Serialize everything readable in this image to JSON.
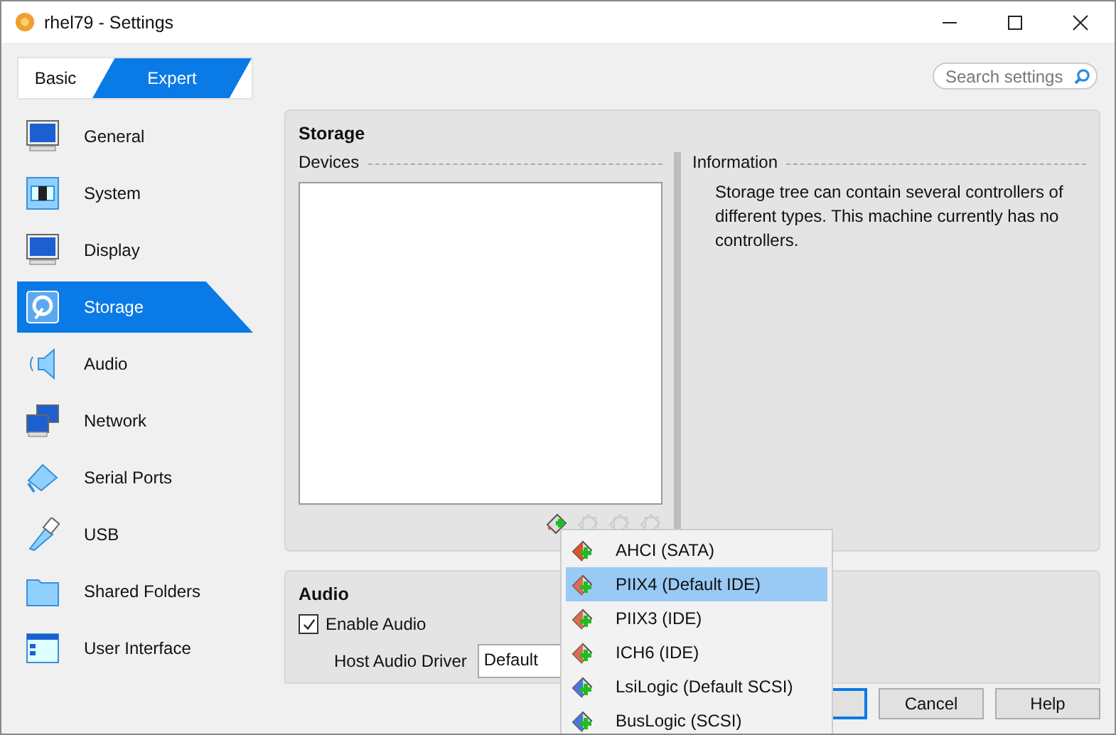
{
  "window": {
    "title": "rhel79 - Settings"
  },
  "mode_tabs": [
    {
      "label": "Basic",
      "selected": false
    },
    {
      "label": "Expert",
      "selected": true
    }
  ],
  "search": {
    "placeholder": "Search settings"
  },
  "sidebar": {
    "items": [
      {
        "label": "General",
        "selected": false
      },
      {
        "label": "System",
        "selected": false
      },
      {
        "label": "Display",
        "selected": false
      },
      {
        "label": "Storage",
        "selected": true
      },
      {
        "label": "Audio",
        "selected": false
      },
      {
        "label": "Network",
        "selected": false
      },
      {
        "label": "Serial Ports",
        "selected": false
      },
      {
        "label": "USB",
        "selected": false
      },
      {
        "label": "Shared Folders",
        "selected": false
      },
      {
        "label": "User Interface",
        "selected": false
      }
    ]
  },
  "storage": {
    "title": "Storage",
    "devices_label": "Devices",
    "information_label": "Information",
    "information_text": "Storage tree can contain several controllers of different types. This machine currently has no controllers.",
    "toolbar": [
      {
        "disabled": false
      },
      {
        "disabled": true
      },
      {
        "disabled": true
      },
      {
        "disabled": true
      }
    ]
  },
  "controller_menu": {
    "items": [
      {
        "label": "AHCI (SATA)",
        "color": "#e0502a",
        "selected": false
      },
      {
        "label": "PIIX4 (Default IDE)",
        "color": "#e06a50",
        "selected": true
      },
      {
        "label": "PIIX3 (IDE)",
        "color": "#e06a50",
        "selected": false
      },
      {
        "label": "ICH6 (IDE)",
        "color": "#e06a50",
        "selected": false
      },
      {
        "label": "LsiLogic (Default SCSI)",
        "color": "#4a78d8",
        "selected": false
      },
      {
        "label": "BusLogic (SCSI)",
        "color": "#4a78d8",
        "selected": false
      }
    ]
  },
  "audio": {
    "title": "Audio",
    "enable_audio": {
      "label": "Enable Audio",
      "checked": true
    },
    "host_driver": {
      "label": "Host Audio Driver",
      "value": "Default"
    }
  },
  "buttons": [
    {
      "label": "Cancel"
    },
    {
      "label": "Help"
    }
  ]
}
